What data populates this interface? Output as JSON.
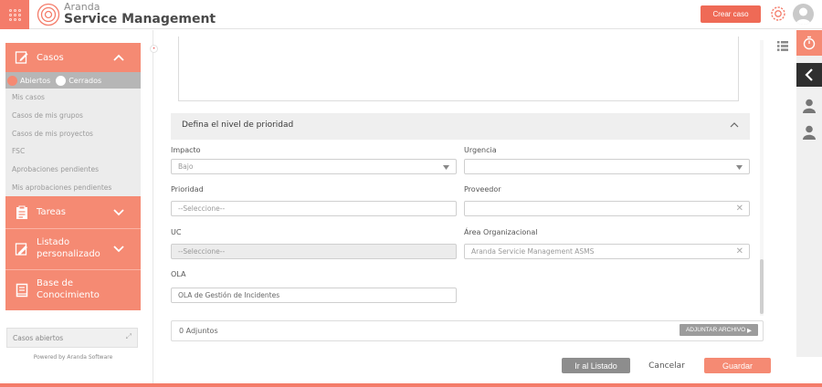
{
  "header": {
    "brand_small": "Aranda",
    "brand_main": "Service Management",
    "create_case": "Crear caso"
  },
  "sidebar": {
    "casos": {
      "label": "Casos",
      "filter_open": "Abiertos",
      "filter_closed": "Cerrados",
      "items": [
        "Mis casos",
        "Casos de mis grupos",
        "Casos de mis proyectos",
        "FSC",
        "Aprobaciones pendientes",
        "Mis aprobaciones pendientes"
      ]
    },
    "tareas": "Tareas",
    "listado_line1": "Listado",
    "listado_line2": "personalizado",
    "base_line1": "Base de",
    "base_line2": "Conocimiento",
    "casos_abiertos": "Casos abiertos",
    "powered": "Powered by Aranda Software"
  },
  "form": {
    "section_title": "Defina el nivel de prioridad",
    "impacto": {
      "label": "Impacto",
      "value": "Bajo"
    },
    "urgencia": {
      "label": "Urgencia",
      "value": ""
    },
    "prioridad": {
      "label": "Prioridad",
      "value": "--Seleccione--"
    },
    "proveedor": {
      "label": "Proveedor",
      "value": ""
    },
    "uc": {
      "label": "UC",
      "value": "--Seleccione--"
    },
    "area": {
      "label": "Área Organizacional",
      "value": "Aranda Servicie Management ASMS"
    },
    "ola": {
      "label": "OLA",
      "value": "OLA de Gestión de Incidentes"
    },
    "adjuntos": "0 Adjuntos",
    "adjuntar": "ADJUNTAR ARCHIVO"
  },
  "actions": {
    "ir_listado": "Ir al Listado",
    "cancelar": "Cancelar",
    "guardar": "Guardar"
  },
  "colors": {
    "accent": "#f58a73",
    "accent_dark": "#ef6a56",
    "dark": "#2f2f2f"
  }
}
